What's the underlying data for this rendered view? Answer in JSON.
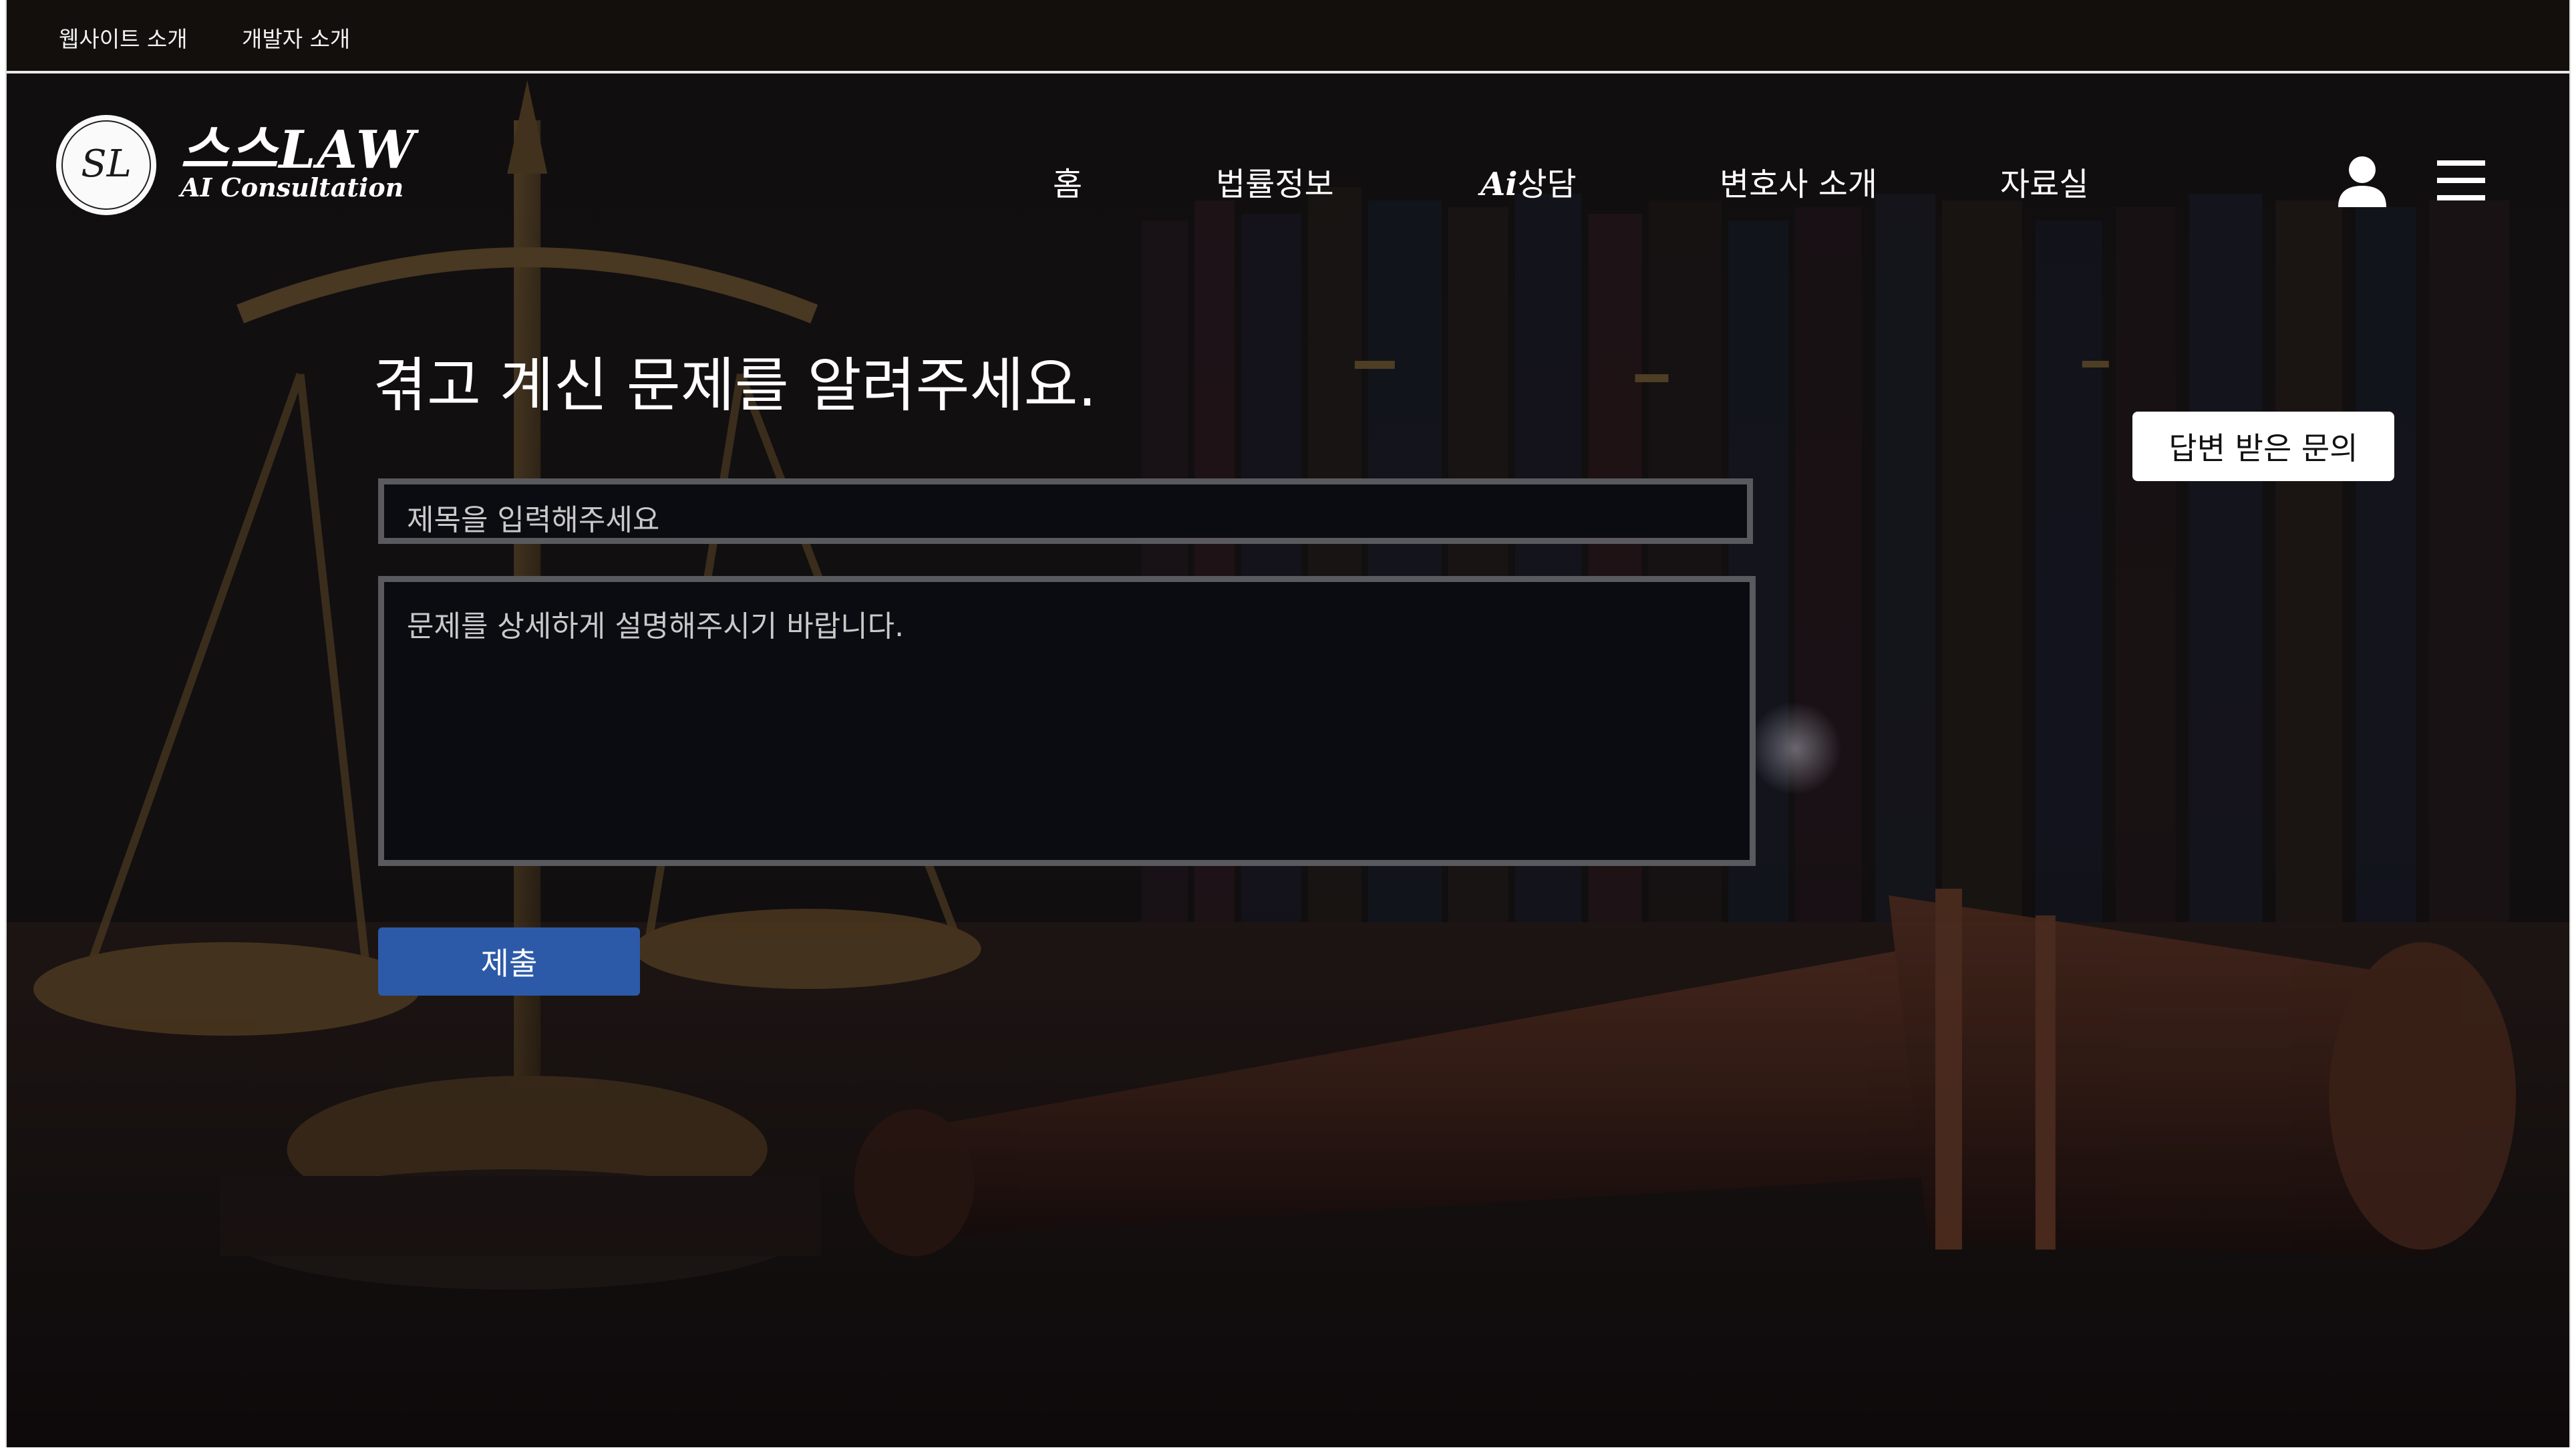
{
  "topbar": {
    "links": [
      "웹사이트 소개",
      "개발자 소개"
    ]
  },
  "header": {
    "logo_monogram": "SL",
    "brand_name": "스스LAW",
    "brand_tagline": "AI Consultation",
    "nav": [
      {
        "label": "홈"
      },
      {
        "label": "법률정보"
      },
      {
        "label_ai": "Ai",
        "label_rest": "상담"
      },
      {
        "label": "변호사 소개"
      },
      {
        "label": "자료실"
      }
    ],
    "icons": [
      "user-icon",
      "hamburger-menu-icon"
    ]
  },
  "main": {
    "title": "겪고 계신 문제를 알려주세요.",
    "answered_button": "답변 받은 문의",
    "title_input": {
      "placeholder": "제목을 입력해주세요",
      "value": ""
    },
    "body_input": {
      "placeholder": "문제를 상세하게 설명해주시기 바랍니다.",
      "value": ""
    },
    "submit_label": "제출"
  },
  "colors": {
    "background_dark": "#0e0d0c",
    "submit_button": "#2c5aa8",
    "input_border": "#5a5a5e",
    "text_primary": "#ffffff"
  }
}
